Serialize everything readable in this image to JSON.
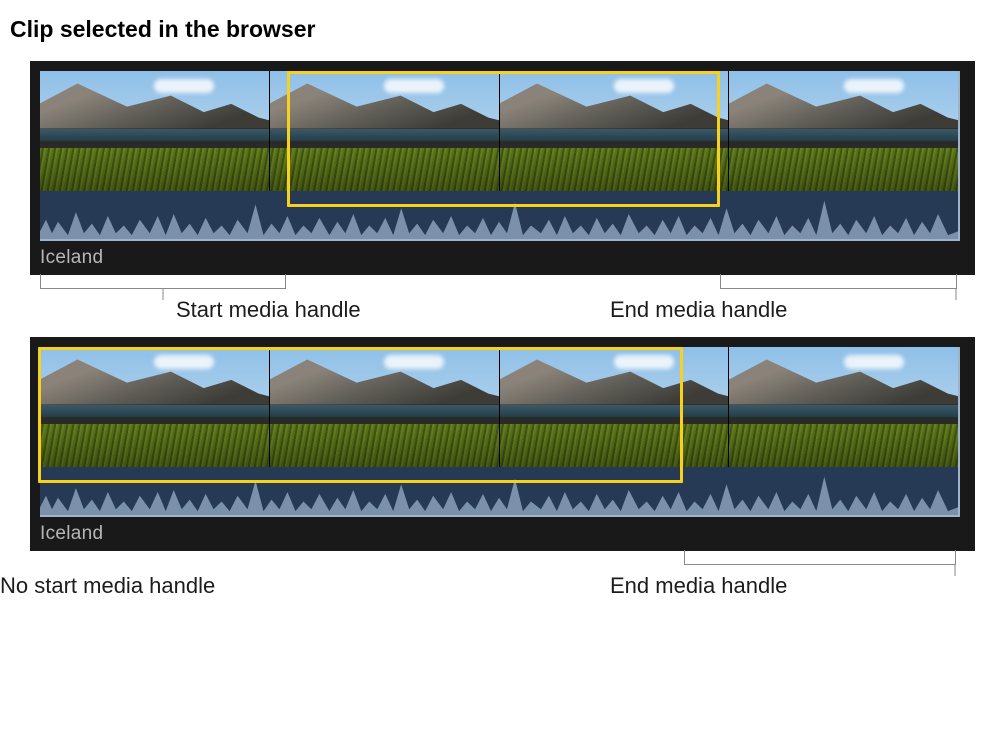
{
  "title": "Clip selected in the browser",
  "example1": {
    "clip_name": "Iceland",
    "labels": {
      "start": "Start media handle",
      "end": "End media handle"
    },
    "selection": {
      "start_pct": 27,
      "end_pct": 74,
      "full_pct": 100
    }
  },
  "example2": {
    "clip_name": "Iceland",
    "labels": {
      "start": "No start media handle",
      "end": "End media handle"
    },
    "selection": {
      "start_pct": 0,
      "end_pct": 70,
      "full_pct": 100
    }
  },
  "colors": {
    "selection_border": "#f7d11c",
    "browser_bg": "#191919",
    "waveform_fill": "#7b90aa"
  }
}
